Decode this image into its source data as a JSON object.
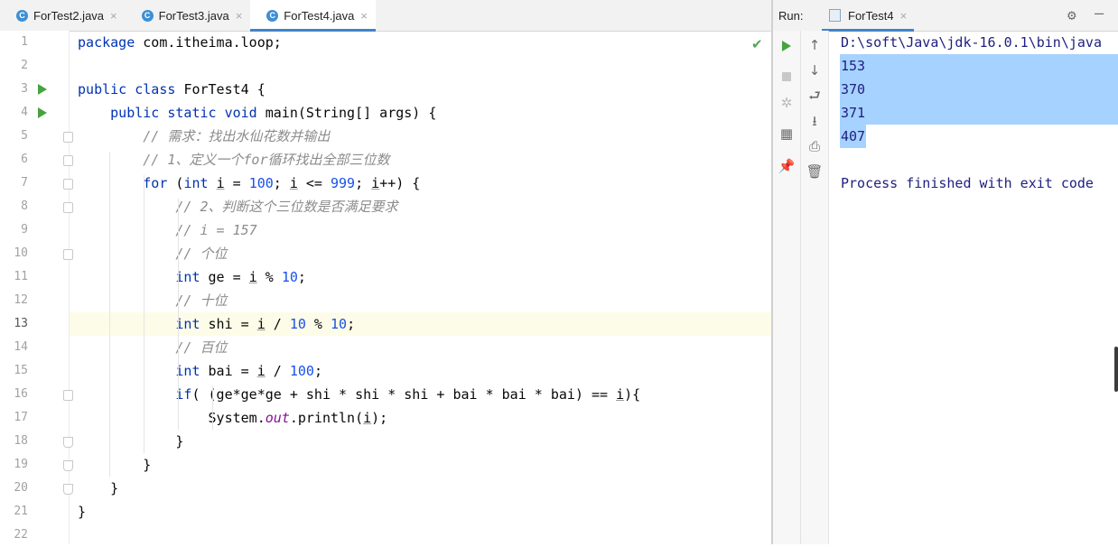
{
  "editor": {
    "tabs": [
      {
        "label": "ForTest2.java",
        "active": false
      },
      {
        "label": "ForTest3.java",
        "active": false
      },
      {
        "label": "ForTest4.java",
        "active": true
      }
    ],
    "line_numbers": [
      "1",
      "2",
      "3",
      "4",
      "5",
      "6",
      "7",
      "8",
      "9",
      "10",
      "11",
      "12",
      "13",
      "14",
      "15",
      "16",
      "17",
      "18",
      "19",
      "20",
      "21",
      "22"
    ],
    "current_line": 13,
    "run_gutter_lines": [
      3,
      4
    ],
    "fold_markers": [
      5,
      6,
      7,
      8,
      10,
      16,
      18,
      19,
      20
    ],
    "code_lines": [
      [
        {
          "t": "package ",
          "c": "kw"
        },
        {
          "t": "com.itheima.loop;"
        }
      ],
      [],
      [
        {
          "t": "public class ",
          "c": "kw"
        },
        {
          "t": "ForTest4 {"
        }
      ],
      [
        {
          "t": "    public static void ",
          "c": "kw"
        },
        {
          "t": "main(String[] args) {"
        }
      ],
      [
        {
          "t": "        // 需求：找出水仙花数并输出",
          "c": "cm"
        }
      ],
      [
        {
          "t": "        // 1、定义一个for循环找出全部三位数",
          "c": "cm"
        }
      ],
      [
        {
          "t": "        for ",
          "c": "kw"
        },
        {
          "t": "("
        },
        {
          "t": "int ",
          "c": "kw"
        },
        {
          "t": "i",
          "c": "var"
        },
        {
          "t": " = "
        },
        {
          "t": "100",
          "c": "num"
        },
        {
          "t": "; "
        },
        {
          "t": "i",
          "c": "var"
        },
        {
          "t": " <= "
        },
        {
          "t": "999",
          "c": "num"
        },
        {
          "t": "; "
        },
        {
          "t": "i",
          "c": "var"
        },
        {
          "t": "++) {"
        }
      ],
      [
        {
          "t": "            // 2、判断这个三位数是否满足要求",
          "c": "cm"
        }
      ],
      [
        {
          "t": "            // i = 157",
          "c": "cm"
        }
      ],
      [
        {
          "t": "            // 个位",
          "c": "cm"
        }
      ],
      [
        {
          "t": "            int ",
          "c": "kw"
        },
        {
          "t": "ge = "
        },
        {
          "t": "i",
          "c": "var"
        },
        {
          "t": " % "
        },
        {
          "t": "10",
          "c": "num"
        },
        {
          "t": ";"
        }
      ],
      [
        {
          "t": "            // 十位",
          "c": "cm"
        }
      ],
      [
        {
          "t": "            int ",
          "c": "kw"
        },
        {
          "t": "shi = "
        },
        {
          "t": "i",
          "c": "var"
        },
        {
          "t": " / "
        },
        {
          "t": "10",
          "c": "num"
        },
        {
          "t": " % "
        },
        {
          "t": "10",
          "c": "num"
        },
        {
          "t": ";"
        }
      ],
      [
        {
          "t": "            // 百位",
          "c": "cm"
        }
      ],
      [
        {
          "t": "            int ",
          "c": "kw"
        },
        {
          "t": "bai = "
        },
        {
          "t": "i",
          "c": "var"
        },
        {
          "t": " / "
        },
        {
          "t": "100",
          "c": "num"
        },
        {
          "t": ";"
        }
      ],
      [
        {
          "t": "            if",
          "c": "kw"
        },
        {
          "t": "( (ge*ge*ge + shi * shi * shi + bai * bai * bai) == "
        },
        {
          "t": "i",
          "c": "var"
        },
        {
          "t": "){"
        }
      ],
      [
        {
          "t": "                System."
        },
        {
          "t": "out",
          "c": "fld"
        },
        {
          "t": ".println("
        },
        {
          "t": "i",
          "c": "var"
        },
        {
          "t": ");"
        }
      ],
      [
        {
          "t": "            }"
        }
      ],
      [
        {
          "t": "        }"
        }
      ],
      [
        {
          "t": "    }"
        }
      ],
      [
        {
          "t": "}"
        }
      ],
      []
    ]
  },
  "run_panel": {
    "label": "Run:",
    "tab_label": "ForTest4",
    "command_line": "D:\\soft\\Java\\jdk-16.0.1\\bin\\java",
    "output": [
      "153",
      "370",
      "371",
      "407"
    ],
    "finished": "Process finished with exit code"
  },
  "icons": {
    "tab_file_icon": "java-class-icon",
    "close": "×",
    "check": "✔",
    "settings": "⚙",
    "minimize": "—"
  },
  "colors": {
    "keyword": "#0033b3",
    "number": "#1750eb",
    "comment": "#8c8c8c",
    "static_field": "#871094",
    "selection": "#a6d2ff",
    "console_text": "#202080",
    "run_green": "#46a340",
    "accent_tab": "#4083c9"
  }
}
